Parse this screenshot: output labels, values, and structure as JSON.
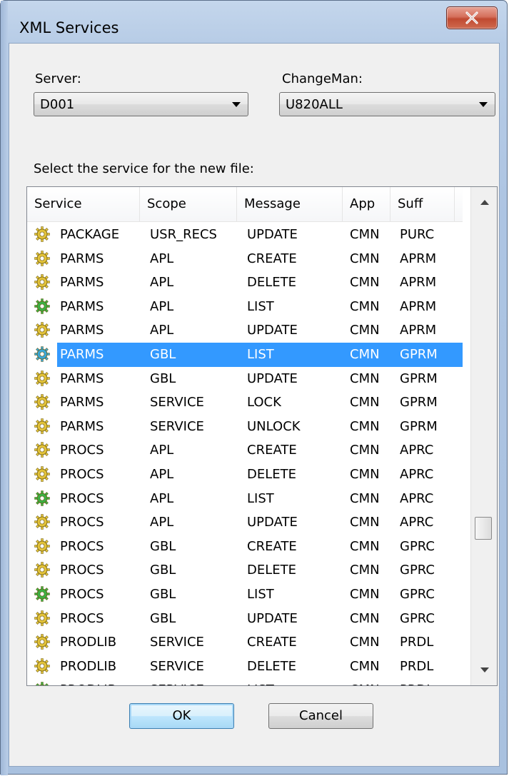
{
  "window": {
    "title": "XML Services"
  },
  "server": {
    "label": "Server:",
    "value": "D001"
  },
  "changeman": {
    "label": "ChangeMan:",
    "value": "U820ALL"
  },
  "list": {
    "prompt": "Select the service for the new file:",
    "columns": [
      "Service",
      "Scope",
      "Message",
      "App",
      "Suff"
    ],
    "rows": [
      {
        "service": "PACKAGE",
        "scope": "USR_RECS",
        "message": "UPDATE",
        "app": "CMN",
        "suff": "PURC",
        "icon": "gear-yellow"
      },
      {
        "service": "PARMS",
        "scope": "APL",
        "message": "CREATE",
        "app": "CMN",
        "suff": "APRM",
        "icon": "gear-yellow"
      },
      {
        "service": "PARMS",
        "scope": "APL",
        "message": "DELETE",
        "app": "CMN",
        "suff": "APRM",
        "icon": "gear-yellow"
      },
      {
        "service": "PARMS",
        "scope": "APL",
        "message": "LIST",
        "app": "CMN",
        "suff": "APRM",
        "icon": "gear-green"
      },
      {
        "service": "PARMS",
        "scope": "APL",
        "message": "UPDATE",
        "app": "CMN",
        "suff": "APRM",
        "icon": "gear-yellow"
      },
      {
        "service": "PARMS",
        "scope": "GBL",
        "message": "LIST",
        "app": "CMN",
        "suff": "GPRM",
        "icon": "gear-blue",
        "selected": true
      },
      {
        "service": "PARMS",
        "scope": "GBL",
        "message": "UPDATE",
        "app": "CMN",
        "suff": "GPRM",
        "icon": "gear-yellow"
      },
      {
        "service": "PARMS",
        "scope": "SERVICE",
        "message": "LOCK",
        "app": "CMN",
        "suff": "GPRM",
        "icon": "gear-yellow"
      },
      {
        "service": "PARMS",
        "scope": "SERVICE",
        "message": "UNLOCK",
        "app": "CMN",
        "suff": "GPRM",
        "icon": "gear-yellow"
      },
      {
        "service": "PROCS",
        "scope": "APL",
        "message": "CREATE",
        "app": "CMN",
        "suff": "APRC",
        "icon": "gear-yellow"
      },
      {
        "service": "PROCS",
        "scope": "APL",
        "message": "DELETE",
        "app": "CMN",
        "suff": "APRC",
        "icon": "gear-yellow"
      },
      {
        "service": "PROCS",
        "scope": "APL",
        "message": "LIST",
        "app": "CMN",
        "suff": "APRC",
        "icon": "gear-green"
      },
      {
        "service": "PROCS",
        "scope": "APL",
        "message": "UPDATE",
        "app": "CMN",
        "suff": "APRC",
        "icon": "gear-yellow"
      },
      {
        "service": "PROCS",
        "scope": "GBL",
        "message": "CREATE",
        "app": "CMN",
        "suff": "GPRC",
        "icon": "gear-yellow"
      },
      {
        "service": "PROCS",
        "scope": "GBL",
        "message": "DELETE",
        "app": "CMN",
        "suff": "GPRC",
        "icon": "gear-yellow"
      },
      {
        "service": "PROCS",
        "scope": "GBL",
        "message": "LIST",
        "app": "CMN",
        "suff": "GPRC",
        "icon": "gear-green"
      },
      {
        "service": "PROCS",
        "scope": "GBL",
        "message": "UPDATE",
        "app": "CMN",
        "suff": "GPRC",
        "icon": "gear-yellow"
      },
      {
        "service": "PRODLIB",
        "scope": "SERVICE",
        "message": "CREATE",
        "app": "CMN",
        "suff": "PRDL",
        "icon": "gear-yellow"
      },
      {
        "service": "PRODLIB",
        "scope": "SERVICE",
        "message": "DELETE",
        "app": "CMN",
        "suff": "PRDL",
        "icon": "gear-yellow"
      },
      {
        "service": "PRODLIB",
        "scope": "SERVICE",
        "message": "LIST",
        "app": "CMN",
        "suff": "PRDL",
        "icon": "gear-green"
      }
    ]
  },
  "buttons": {
    "ok": "OK",
    "cancel": "Cancel"
  },
  "colors": {
    "gear-yellow": "#e2c23a",
    "gear-green": "#3cb043",
    "gear-blue": "#3aa7d6",
    "selection": "#3399ff"
  }
}
